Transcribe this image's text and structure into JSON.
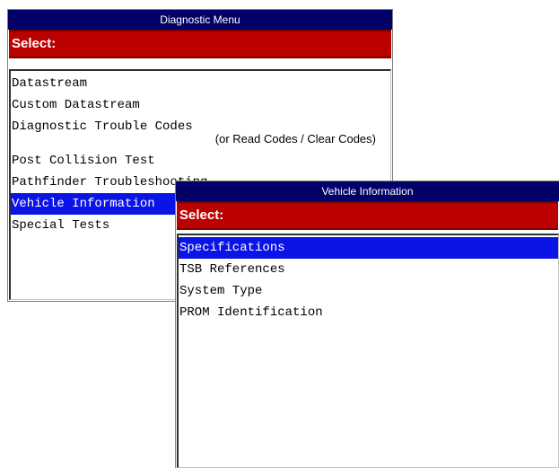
{
  "diagnostic_menu": {
    "title": "Diagnostic Menu",
    "select_label": "Select:",
    "items": [
      {
        "label": "Datastream"
      },
      {
        "label": "Custom Datastream"
      },
      {
        "label": "Diagnostic Trouble Codes",
        "sub": "(or Read Codes / Clear Codes)"
      },
      {
        "label": "Post Collision Test"
      },
      {
        "label": "Pathfinder Troubleshooting"
      },
      {
        "label": "Vehicle Information",
        "selected": true
      },
      {
        "label": "Special Tests"
      }
    ]
  },
  "vehicle_information": {
    "title": "Vehicle Information",
    "select_label": "Select:",
    "items": [
      {
        "label": "Specifications",
        "selected": true
      },
      {
        "label": "TSB References"
      },
      {
        "label": "System Type"
      },
      {
        "label": "PROM Identification"
      }
    ]
  },
  "colors": {
    "title_bar": "#000066",
    "select_bar": "#bb0000",
    "highlight": "#0a14e6"
  }
}
